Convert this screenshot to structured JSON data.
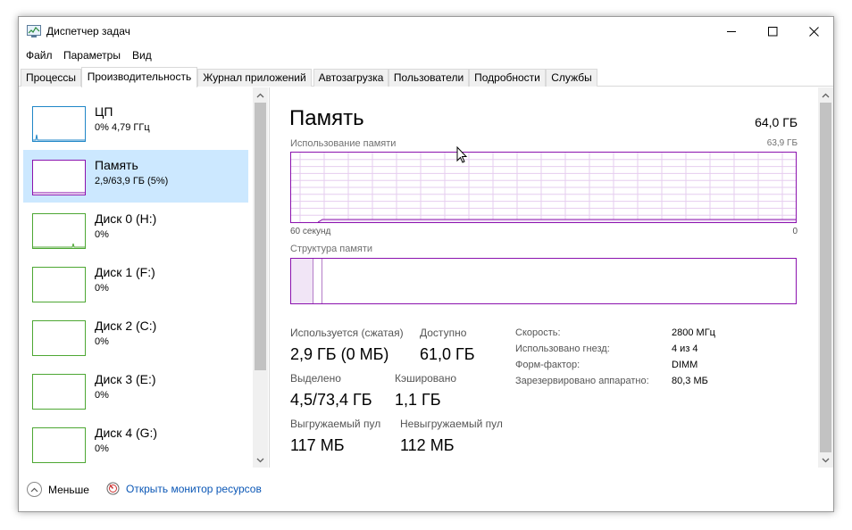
{
  "window": {
    "title": "Диспетчер задач",
    "accent_color": "#8b12ae",
    "selected_color": "#cce8ff"
  },
  "menu": [
    "Файл",
    "Параметры",
    "Вид"
  ],
  "tabs": [
    "Процессы",
    "Производительность",
    "Журнал приложений",
    "Автозагрузка",
    "Пользователи",
    "Подробности",
    "Службы"
  ],
  "active_tab": "Производительность",
  "sidebar": {
    "items": [
      {
        "title": "ЦП",
        "sub": "0% 4,79 ГГц",
        "color": "#1f86c7"
      },
      {
        "title": "Память",
        "sub": "2,9/63,9 ГБ (5%)",
        "color": "#8b12ae"
      },
      {
        "title": "Диск 0 (H:)",
        "sub": "0%",
        "color": "#4da733"
      },
      {
        "title": "Диск 1 (F:)",
        "sub": "0%",
        "color": "#4da733"
      },
      {
        "title": "Диск 2 (C:)",
        "sub": "0%",
        "color": "#4da733"
      },
      {
        "title": "Диск 3 (E:)",
        "sub": "0%",
        "color": "#4da733"
      },
      {
        "title": "Диск 4 (G:)",
        "sub": "0%",
        "color": "#4da733"
      }
    ],
    "selected_index": 1
  },
  "main": {
    "title": "Память",
    "total": "64,0 ГБ",
    "usage_label": "Использование памяти",
    "usage_max": "63,9 ГБ",
    "time_left": "60 секунд",
    "time_right": "0",
    "structure_label": "Структура памяти"
  },
  "stats": {
    "in_use_label": "Используется (сжатая)",
    "in_use_value": "2,9 ГБ (0 МБ)",
    "available_label": "Доступно",
    "available_value": "61,0 ГБ",
    "committed_label": "Выделено",
    "committed_value": "4,5/73,4 ГБ",
    "cached_label": "Кэшировано",
    "cached_value": "1,1 ГБ",
    "paged_label": "Выгружаемый пул",
    "paged_value": "117 МБ",
    "nonpaged_label": "Невыгружаемый пул",
    "nonpaged_value": "112 МБ"
  },
  "props": [
    {
      "label": "Скорость:",
      "value": "2800 МГц"
    },
    {
      "label": "Использовано гнезд:",
      "value": "4 из 4"
    },
    {
      "label": "Форм-фактор:",
      "value": "DIMM"
    },
    {
      "label": "Зарезервировано аппаратно:",
      "value": "80,3 МБ"
    }
  ],
  "footer": {
    "less_label": "Меньше",
    "monitor_label": "Открыть монитор ресурсов"
  }
}
